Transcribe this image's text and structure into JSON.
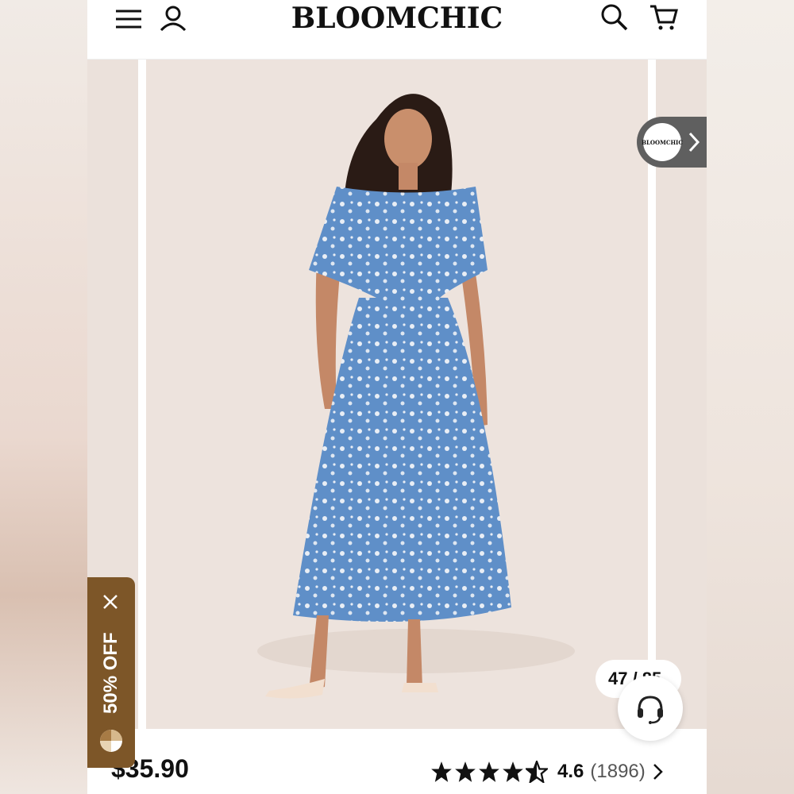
{
  "header": {
    "brand": "BLOOMCHIC",
    "icons": [
      "menu-icon",
      "user-icon",
      "search-icon",
      "cart-icon"
    ]
  },
  "gallery": {
    "shop_badge_text": "BLOOMCHIC",
    "counter": "47 / 85",
    "image_description_icon": "product-photo"
  },
  "promo": {
    "label": "50% OFF",
    "color": "#7d5628"
  },
  "product": {
    "price": "$35.90",
    "rating": "4.6",
    "review_count": "(1896)",
    "stars_filled": 4.5
  }
}
